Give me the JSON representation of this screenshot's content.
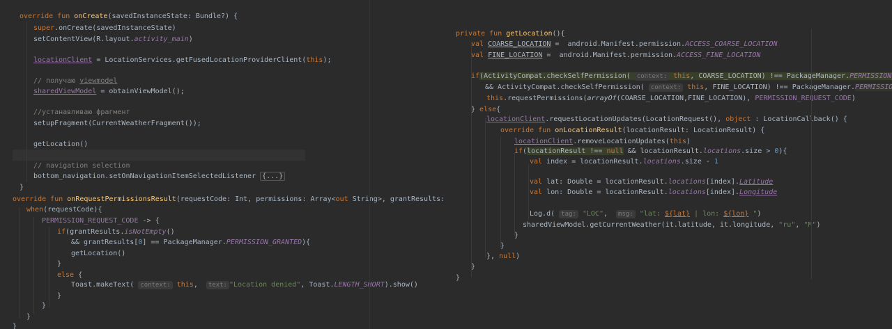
{
  "left_code": {
    "l1": {
      "kw": "override fun",
      "fn": "onCreate",
      "rest": "(savedInstanceState: Bundle?) {"
    },
    "l2": {
      "kw": "super",
      "rest": ".onCreate(savedInstanceState)"
    },
    "l3": {
      "pre": "setContentView(R.layout.",
      "const": "activity_main",
      "post": ")"
    },
    "l4": {
      "prop": "locationClient",
      "rest": " = LocationServices.getFusedLocationProviderClient(",
      "kw": "this",
      "post": ");"
    },
    "l5": {
      "cmt": "// получаю ",
      "cmt_ul": "viewmodel"
    },
    "l6": {
      "prop": "sharedViewModel",
      "rest": " = obtainViewModel();"
    },
    "l7": {
      "cmt": "//устанавливаю фрагмент"
    },
    "l8": {
      "text": "setupFragment(CurrentWeatherFragment());"
    },
    "l9": {
      "text": "getLocation()"
    },
    "l10": {
      "cmt": "// navigation selection"
    },
    "l11": {
      "pre": "bottom_navigation.setOnNavigationItemSelectedListener ",
      "fold": "{...}"
    },
    "l12": {
      "text": "}"
    },
    "l13": {
      "kw": "override fun",
      "fn": "onRequestPermissionsResult",
      "pre": "(requestCode: Int, permissions: Array<",
      "kw2": "out",
      "post": " String>, grantResults: IntArray) {"
    },
    "l14": {
      "kw": "when",
      "rest": "(requestCode){"
    },
    "l15": {
      "const": "PERMISSION_REQUEST_CODE",
      "rest": " -> {"
    },
    "l16": {
      "kw": "if",
      "pre": "(grantResults.",
      "itp": "isNotEmpty",
      "post": "()"
    },
    "l17": {
      "pre": "&& grantResults[",
      "num": "0",
      "mid": "] == PackageManager.",
      "const": "PERMISSION_GRANTED",
      "post": "){"
    },
    "l18": {
      "text": "getLocation()"
    },
    "l19": {
      "text": "}"
    },
    "l20": {
      "kw": "else",
      "rest": " {"
    },
    "l21": {
      "pre": "Toast.makeText( ",
      "hint1": "context:",
      "kw": "this",
      "sep": ",  ",
      "hint2": "text:",
      "str": "\"Location denied\"",
      "mid": ", Toast.",
      "const": "LENGTH_SHORT",
      "post": ").show()"
    },
    "l22": {
      "text": "}"
    },
    "l23": {
      "text": "}"
    },
    "l24": {
      "text": "}"
    },
    "l25": {
      "text": "}"
    }
  },
  "right_code": {
    "r1": {
      "kw": "private fun",
      "fn": "getLocation",
      "rest": "(){"
    },
    "r2": {
      "kw": "val",
      "ul": "COARSE_LOCATION",
      "rest": " =  android.Manifest.permission.",
      "const": "ACCESS_COARSE_LOCATION"
    },
    "r3": {
      "kw": "val",
      "ul": "FINE_LOCATION",
      "rest": " =  android.Manifest.permission.",
      "const": "ACCESS_FINE_LOCATION"
    },
    "r4": {
      "kw": "if",
      "pre": "(ActivityCompat.checkSelfPermission( ",
      "hint": "context:",
      "kw2": "this",
      "mid": ", COARSE_LOCATION) !== PackageManager.",
      "const": "PERMISSION_GRANTED"
    },
    "r5": {
      "pre": "&& ActivityCompat.checkSelfPermission( ",
      "hint": "context:",
      "kw": "this",
      "mid": ", FINE_LOCATION) !== PackageManager.",
      "const": "PERMISSION_GRANTED",
      "post": ") {"
    },
    "r6": {
      "kw": "this",
      "pre": ".requestPermissions(",
      "itp": "arrayOf",
      "mid": "(COARSE_LOCATION,FINE_LOCATION), ",
      "const": "PERMISSION_REQUEST_CODE",
      "post": ")"
    },
    "r7": {
      "pre": "} ",
      "kw": "else",
      "post": "{"
    },
    "r8": {
      "prop": "locationClient",
      "pre": ".requestLocationUpdates(LocationRequest(), ",
      "kw": "object",
      "post": " : LocationCallback() {"
    },
    "r9": {
      "kw": "override fun",
      "fn": "onLocationResult",
      "rest": "(locationResult: LocationResult) {"
    },
    "r10": {
      "prop": "locationClient",
      "rest": ".removeLocationUpdates(",
      "kw": "this",
      "post": ")"
    },
    "r11": {
      "kw": "if",
      "hlpre": "locationResult !== ",
      "kw2": "null",
      "mid": " && locationResult.",
      "itp": "locations",
      "post": ".size > ",
      "num": "0",
      "end": "){"
    },
    "r12": {
      "kw": "val",
      "pre": " index = locationResult.",
      "itp": "locations",
      "mid": ".size - ",
      "num": "1"
    },
    "r13": {
      "kw": "val",
      "pre": " lat: Double = locationResult.",
      "itp": "locations",
      "mid": "[index].",
      "itp2": "Latitude"
    },
    "r14": {
      "kw": "val",
      "pre": " lon: Double = locationResult.",
      "itp": "locations",
      "mid": "[index].",
      "itp2": "Longitude"
    },
    "r15": {
      "pre": "Log.d( ",
      "hint1": "tag:",
      "str1": "\"LOC\"",
      "sep": ",  ",
      "hint2": "msg:",
      "str2a": "\"lat: ",
      "ul1": "${lat}",
      "str2b": " | lon: ",
      "ul2": "${lon}",
      "str2c": " \"",
      "post": ")"
    },
    "r16": {
      "pre": "sharedViewModel.getCurrentWeather(it.latitude, it.longitude, ",
      "str1": "\"ru\"",
      "sep": ", ",
      "str2": "\"M\"",
      "post": ")"
    },
    "r17": {
      "text": "}"
    },
    "r18": {
      "text": "}"
    },
    "r19": {
      "pre": "}, ",
      "kw": "null",
      "post": ")"
    },
    "r20": {
      "text": "}"
    },
    "r21": {
      "text": "}"
    }
  },
  "colors": {
    "background": "#2b2b2b",
    "keyword": "#cc7832",
    "function": "#ffc66d",
    "string": "#6a8759",
    "number": "#6897bb",
    "comment": "#808080",
    "constant": "#9876aa",
    "text": "#a9b7c6"
  }
}
